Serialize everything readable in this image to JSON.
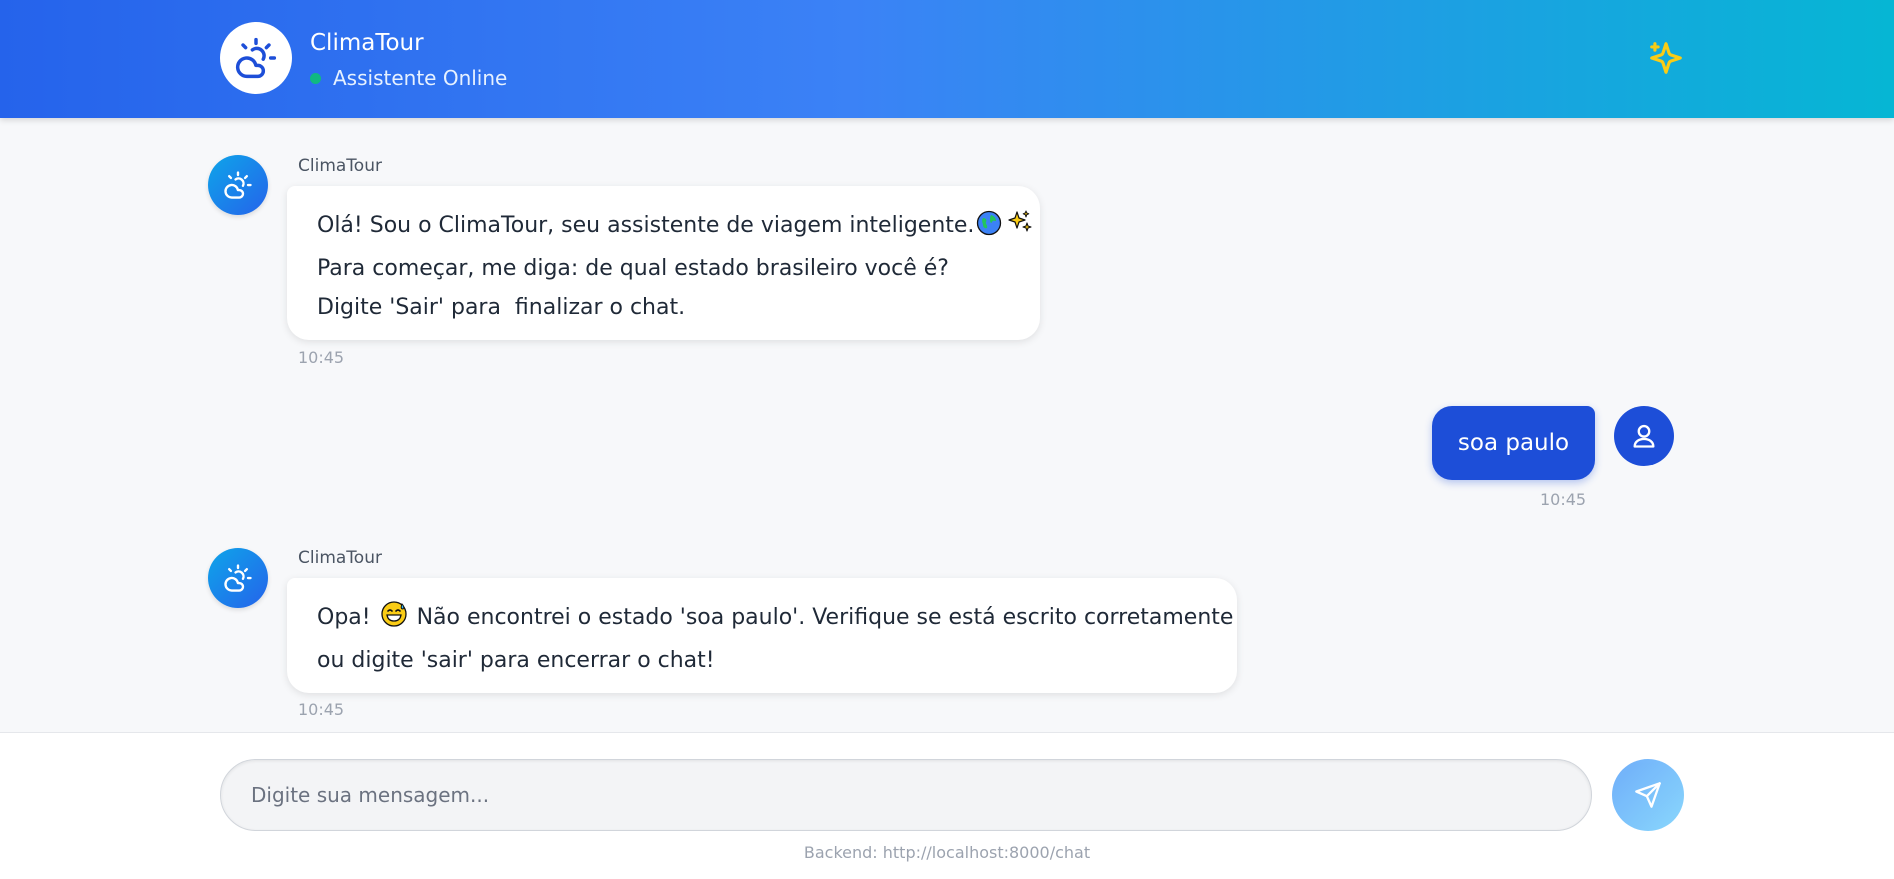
{
  "header": {
    "title": "ClimaTour",
    "status": "Assistente Online",
    "logo_icon": "weather-sun-cloud-icon",
    "action_icon": "sparkles-icon",
    "colors": {
      "gradient_start": "#2563eb",
      "gradient_end": "#06b6d4",
      "online": "#10b981",
      "sparkle": "#facc15"
    }
  },
  "messages": [
    {
      "from": "bot",
      "sender": "ClimaTour",
      "lines": [
        "Olá! Sou o ClimaTour, seu assistente de viagem inteligente.",
        "Para começar, me diga: de qual estado brasileiro você é?",
        "Digite 'Sair' para  finalizar o chat."
      ],
      "time": "10:45"
    },
    {
      "from": "user",
      "text": "soa paulo",
      "time": "10:45"
    },
    {
      "from": "bot",
      "sender": "ClimaTour",
      "lines": [
        "Opa!",
        "Não encontrei o estado 'soa paulo'. Verifique se está escrito corretamente",
        "ou digite 'sair' para encerrar o chat!"
      ],
      "time": "10:45"
    }
  ],
  "composer": {
    "placeholder": "Digite sua mensagem...",
    "send_icon": "send-icon"
  },
  "footer": {
    "backend": "Backend: http://localhost:8000/chat"
  }
}
